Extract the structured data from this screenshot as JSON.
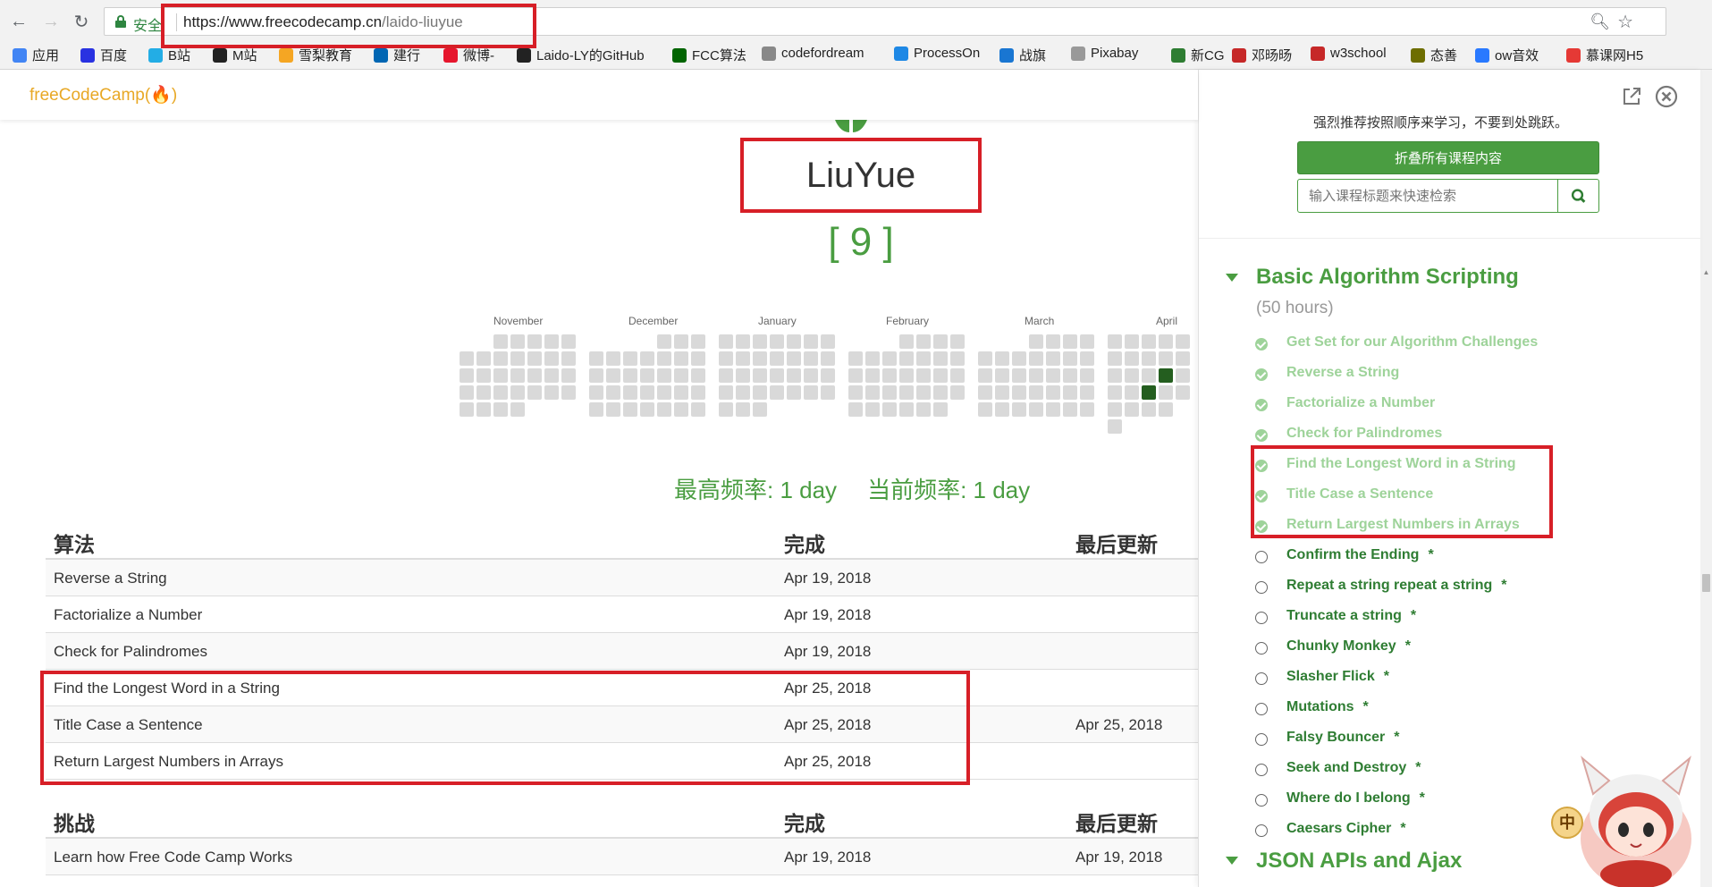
{
  "browser": {
    "secure_label": "安全",
    "url_host": "https://www.freecodecamp.cn",
    "url_path": "/laido-liuyue",
    "bookmarks": [
      {
        "label": "应用",
        "icon": "apps-grid-icon",
        "color": "#4285f4"
      },
      {
        "label": "百度",
        "icon": "baidu-paw-icon",
        "color": "#2932e1"
      },
      {
        "label": "B站",
        "icon": "bilibili-tv-icon",
        "color": "#23ade5"
      },
      {
        "label": "M站",
        "icon": "github-cat-icon",
        "color": "#222222"
      },
      {
        "label": "雪梨教育",
        "icon": "flame-icon",
        "color": "#f5a623"
      },
      {
        "label": "建行",
        "icon": "ccb-icon",
        "color": "#0066b3"
      },
      {
        "label": "微博-",
        "icon": "weibo-icon",
        "color": "#e6162d"
      },
      {
        "label": "Laido-LY的GitHub",
        "icon": "github-icon",
        "color": "#222222"
      },
      {
        "label": "FCC算法",
        "icon": "fcc-icon",
        "color": "#006400"
      },
      {
        "label": "codefordream",
        "icon": "globe-icon",
        "color": "#888888"
      },
      {
        "label": "ProcessOn",
        "icon": "processon-icon",
        "color": "#1e88e5"
      },
      {
        "label": "战旗",
        "icon": "flag-icon",
        "color": "#1976d2"
      },
      {
        "label": "Pixabay",
        "icon": "page-icon",
        "color": "#999999"
      },
      {
        "label": "新CG",
        "icon": "cg-icon",
        "color": "#2e7d32"
      },
      {
        "label": "邓旸旸",
        "icon": "feather-icon",
        "color": "#c62828"
      },
      {
        "label": "w3school",
        "icon": "w3school-icon",
        "color": "#c62828"
      },
      {
        "label": "态善",
        "icon": "shield-icon",
        "color": "#6d6d00"
      },
      {
        "label": "ow音效",
        "icon": "v-icon",
        "color": "#2979ff"
      },
      {
        "label": "慕课网H5",
        "icon": "fire-icon",
        "color": "#e53935"
      }
    ]
  },
  "site": {
    "logo": {
      "free": "free",
      "code": "CodeCamp",
      "flame": "(🔥)"
    }
  },
  "profile": {
    "username": "LiuYue",
    "points": "[ 9 ]",
    "streak_longest": "最高频率: 1 day",
    "streak_current": "当前频率: 1 day",
    "months": [
      "November",
      "December",
      "January",
      "February",
      "March",
      "April"
    ]
  },
  "algorithms_table": {
    "headers": [
      "算法",
      "完成",
      "最后更新"
    ],
    "rows": [
      [
        "Reverse a String",
        "Apr 19, 2018",
        ""
      ],
      [
        "Factorialize a Number",
        "Apr 19, 2018",
        ""
      ],
      [
        "Check for Palindromes",
        "Apr 19, 2018",
        ""
      ],
      [
        "Find the Longest Word in a String",
        "Apr 25, 2018",
        ""
      ],
      [
        "Title Case a Sentence",
        "Apr 25, 2018",
        "Apr 25, 2018"
      ],
      [
        "Return Largest Numbers in Arrays",
        "Apr 25, 2018",
        ""
      ]
    ]
  },
  "challenges_table": {
    "headers": [
      "挑战",
      "完成",
      "最后更新"
    ],
    "rows": [
      [
        "Learn how Free Code Camp Works",
        "Apr 19, 2018",
        "Apr 19, 2018"
      ]
    ]
  },
  "panel": {
    "notice": "强烈推荐按照顺序来学习，不要到处跳跃。",
    "collapse_label": "折叠所有课程内容",
    "search_placeholder": "输入课程标题来快速检索",
    "section_title": "Basic Algorithm Scripting",
    "section_hours": "(50 hours)",
    "challenges": [
      {
        "label": "Get Set for our Algorithm Challenges",
        "done": true
      },
      {
        "label": "Reverse a String",
        "done": true
      },
      {
        "label": "Factorialize a Number",
        "done": true
      },
      {
        "label": "Check for Palindromes",
        "done": true
      },
      {
        "label": "Find the Longest Word in a String",
        "done": true
      },
      {
        "label": "Title Case a Sentence",
        "done": true
      },
      {
        "label": "Return Largest Numbers in Arrays",
        "done": true
      },
      {
        "label": "Confirm the Ending",
        "done": false
      },
      {
        "label": "Repeat a string repeat a string",
        "done": false
      },
      {
        "label": "Truncate a string",
        "done": false
      },
      {
        "label": "Chunky Monkey",
        "done": false
      },
      {
        "label": "Slasher Flick",
        "done": false
      },
      {
        "label": "Mutations",
        "done": false
      },
      {
        "label": "Falsy Bouncer",
        "done": false
      },
      {
        "label": "Seek and Destroy",
        "done": false
      },
      {
        "label": "Where do I belong",
        "done": false
      },
      {
        "label": "Caesars Cipher",
        "done": false
      }
    ],
    "asterisk": "*",
    "next_section_title": "JSON APIs and Ajax"
  },
  "ime": {
    "label": "中"
  },
  "colors": {
    "brand_green": "#4a9d41",
    "completed_green": "#9ed39a",
    "todo_green": "#2f7d33",
    "annotation_red": "#d71f27"
  }
}
